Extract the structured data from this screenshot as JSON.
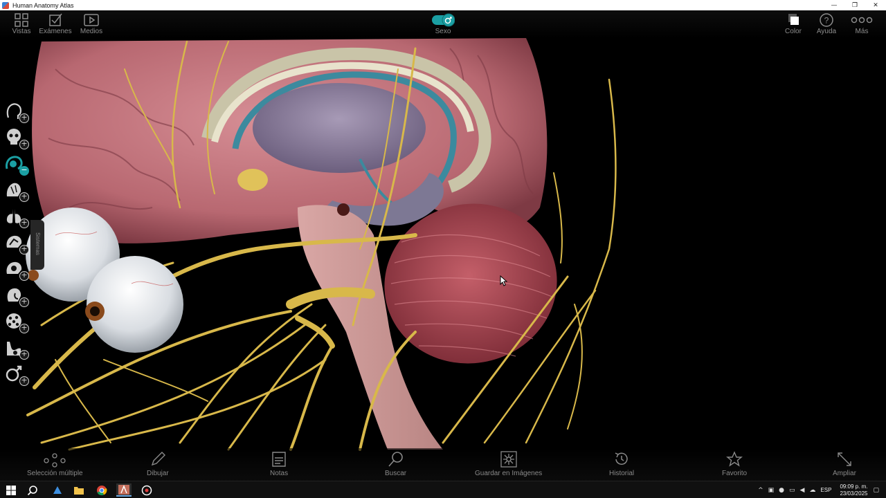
{
  "window": {
    "title": "Human Anatomy Atlas",
    "controls": [
      "—",
      "❐",
      "✕"
    ]
  },
  "toolbar_top": {
    "vistas": "Vistas",
    "examenes": "Exámenes",
    "medios": "Medios",
    "sexo": "Sexo",
    "color": "Color",
    "ayuda": "Ayuda",
    "mas": "Más"
  },
  "sidebar": {
    "tab_label": "Sistemas",
    "systems": [
      {
        "icon": "skin-head-icon",
        "state": "add"
      },
      {
        "icon": "skeleton-head-icon",
        "state": "add"
      },
      {
        "icon": "nervous-head-icon",
        "state": "remove"
      },
      {
        "icon": "muscle-head-icon",
        "state": "add"
      },
      {
        "icon": "lungs-icon",
        "state": "add"
      },
      {
        "icon": "vessels-head-icon",
        "state": "add"
      },
      {
        "icon": "lymph-head-icon",
        "state": "add"
      },
      {
        "icon": "digestive-head-icon",
        "state": "add"
      },
      {
        "icon": "cells-icon",
        "state": "add"
      },
      {
        "icon": "urinary-icon",
        "state": "add"
      },
      {
        "icon": "reproductive-icon",
        "state": "add"
      }
    ]
  },
  "toolbar_bottom": {
    "seleccion": "Selección múltiple",
    "dibujar": "Dibujar",
    "notas": "Notas",
    "buscar": "Buscar",
    "guardar": "Guardar en Imágenes",
    "historial": "Historial",
    "favorito": "Favorito",
    "ampliar": "Ampliar"
  },
  "taskbar": {
    "language": "ESP",
    "time": "09:09 p. m.",
    "date": "23/03/2025"
  },
  "colors": {
    "accent": "#1b9fa3",
    "nerve": "#d8b84a",
    "brain": "#c97b84",
    "cerebellum": "#b24d58"
  }
}
